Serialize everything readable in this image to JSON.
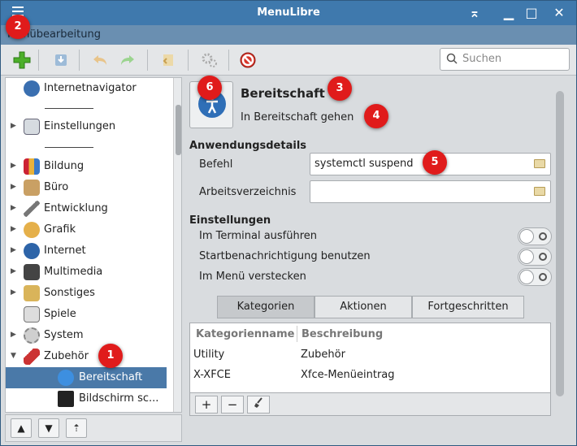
{
  "window": {
    "title": "MenuLibre",
    "minimize_glyph": "▁",
    "restore_glyph": "⌅",
    "maximize_glyph": "□",
    "close_glyph": "✕"
  },
  "menubar": {
    "label": "Menübearbeitung"
  },
  "toolbar": {
    "search_placeholder": "Suchen"
  },
  "sidebar": {
    "items": [
      {
        "label": "Internetnavigator",
        "icon": "globe-icon"
      },
      {
        "label": "Einstellungen",
        "icon": "settings-panel-icon"
      },
      {
        "label": "Bildung",
        "icon": "books-icon"
      },
      {
        "label": "Büro",
        "icon": "office-icon"
      },
      {
        "label": "Entwicklung",
        "icon": "development-icon"
      },
      {
        "label": "Grafik",
        "icon": "graphics-icon"
      },
      {
        "label": "Internet",
        "icon": "globe-icon"
      },
      {
        "label": "Multimedia",
        "icon": "multimedia-icon"
      },
      {
        "label": "Sonstiges",
        "icon": "misc-icon"
      },
      {
        "label": "Spiele",
        "icon": "games-icon"
      },
      {
        "label": "System",
        "icon": "gear-icon"
      },
      {
        "label": "Zubehör",
        "icon": "accessories-icon"
      },
      {
        "label": "Bereitschaft",
        "icon": "standby-icon"
      },
      {
        "label": "Bildschirm sc...",
        "icon": "monitor-icon"
      }
    ]
  },
  "app": {
    "name": "Bereitschaft",
    "comment": "In Bereitschaft gehen",
    "details_title": "Anwendungsdetails",
    "command_label": "Befehl",
    "command_value": "systemctl suspend",
    "workdir_label": "Arbeitsverzeichnis",
    "workdir_value": "",
    "settings_title": "Einstellungen",
    "opt_terminal": "Im Terminal ausführen",
    "opt_startup": "Startbenachrichtigung benutzen",
    "opt_hide": "Im Menü verstecken"
  },
  "tabs": [
    "Kategorien",
    "Aktionen",
    "Fortgeschritten"
  ],
  "categories": {
    "headers": [
      "Kategorienname",
      "Beschreibung"
    ],
    "rows": [
      [
        "Utility",
        "Zubehör"
      ],
      [
        "X-XFCE",
        "Xfce-Menüeintrag"
      ]
    ]
  },
  "badges": [
    "1",
    "2",
    "3",
    "4",
    "5",
    "6"
  ],
  "colors": {
    "titlebar": "#3f79ad",
    "selection": "#4a79a8",
    "badge": "#e01b1b"
  }
}
